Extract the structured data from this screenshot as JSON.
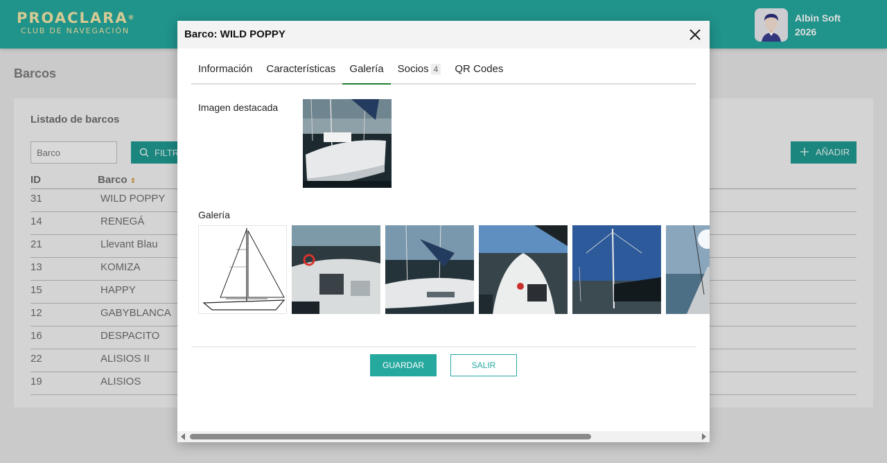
{
  "header": {
    "logo_main": "PROACLARA",
    "logo_mark": "®",
    "logo_sub": "CLUB DE NAVEGACIÓN",
    "user_name": "Albin Soft",
    "user_year": "2026"
  },
  "page": {
    "title": "Barcos",
    "card_title": "Listado de barcos",
    "filter_placeholder": "Barco",
    "filter_button": "FILTRAR",
    "add_button": "AÑADIR",
    "columns": {
      "id": "ID",
      "name": "Barco"
    },
    "rows": [
      {
        "id": "31",
        "name": "WILD POPPY"
      },
      {
        "id": "14",
        "name": "RENEGÁ"
      },
      {
        "id": "21",
        "name": "Llevant Blau"
      },
      {
        "id": "13",
        "name": "KOMIZA"
      },
      {
        "id": "15",
        "name": "HAPPY"
      },
      {
        "id": "12",
        "name": "GABYBLANCA"
      },
      {
        "id": "16",
        "name": "DESPACITO"
      },
      {
        "id": "22",
        "name": "ALISIOS II"
      },
      {
        "id": "19",
        "name": "ALISIOS"
      }
    ]
  },
  "modal": {
    "title": "Barco: WILD POPPY",
    "tabs": [
      {
        "label": "Información"
      },
      {
        "label": "Características"
      },
      {
        "label": "Galería",
        "active": true
      },
      {
        "label": "Socios",
        "badge": "4"
      },
      {
        "label": "QR Codes"
      }
    ],
    "featured_label": "Imagen destacada",
    "gallery_label": "Galería",
    "save_button": "GUARDAR",
    "exit_button": "SALIR"
  },
  "colors": {
    "brand": "#25a89e",
    "logo_text": "#f3e6a8",
    "active_tab": "#1a7f2f"
  }
}
